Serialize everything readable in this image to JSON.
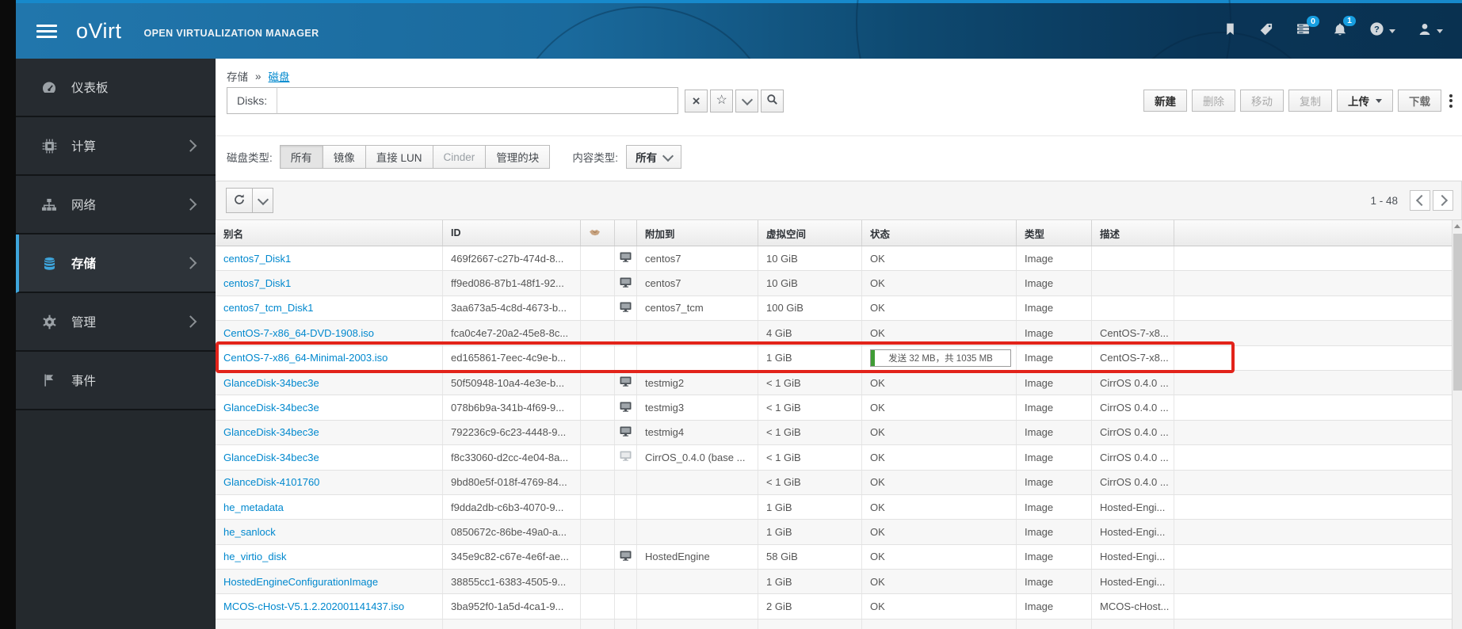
{
  "masthead": {
    "brand": "oVirt",
    "brand_sub": "OPEN VIRTUALIZATION MANAGER",
    "tasks_badge": "0",
    "alerts_badge": "1"
  },
  "sidebar": {
    "items": [
      {
        "label": "仪表板",
        "icon": "dashboard-gauge-icon",
        "active": false,
        "chevron": false
      },
      {
        "label": "计算",
        "icon": "compute-chip-icon",
        "active": false,
        "chevron": true
      },
      {
        "label": "网络",
        "icon": "network-sitemap-icon",
        "active": false,
        "chevron": true
      },
      {
        "label": "存储",
        "icon": "storage-database-icon",
        "active": true,
        "chevron": true
      },
      {
        "label": "管理",
        "icon": "admin-gear-icon",
        "active": false,
        "chevron": true
      },
      {
        "label": "事件",
        "icon": "events-flag-icon",
        "active": false,
        "chevron": false
      }
    ]
  },
  "breadcrumb": {
    "section": "存储",
    "separator": "»",
    "current": "磁盘"
  },
  "search": {
    "label": "Disks:",
    "value": ""
  },
  "actions": {
    "new": "新建",
    "delete": "删除",
    "move": "移动",
    "copy": "复制",
    "upload": "上传",
    "download": "下载"
  },
  "filters": {
    "disk_type_label": "磁盘类型:",
    "disk_type_options": [
      {
        "label": "所有",
        "active": true
      },
      {
        "label": "镜像",
        "active": false
      },
      {
        "label": "直接 LUN",
        "active": false
      },
      {
        "label": "Cinder",
        "active": false
      },
      {
        "label": "管理的块",
        "active": false
      }
    ],
    "content_type_label": "内容类型:",
    "content_type_value": "所有"
  },
  "grid": {
    "range": "1 - 48"
  },
  "table": {
    "columns": {
      "alias": "别名",
      "id": "ID",
      "attached": "附加到",
      "vsize": "虚拟空间",
      "status": "状态",
      "type": "类型",
      "desc": "描述"
    },
    "rows": [
      {
        "alias": "centos7_Disk1",
        "id": "469f2667-c27b-474d-8...",
        "attach": "vm",
        "attached_to": "centos7",
        "size": "10 GiB",
        "status": "OK",
        "type": "Image",
        "desc": ""
      },
      {
        "alias": "centos7_Disk1",
        "id": "ff9ed086-87b1-48f1-92...",
        "attach": "vm",
        "attached_to": "centos7",
        "size": "10 GiB",
        "status": "OK",
        "type": "Image",
        "desc": ""
      },
      {
        "alias": "centos7_tcm_Disk1",
        "id": "3aa673a5-4c8d-4673-b...",
        "attach": "vm",
        "attached_to": "centos7_tcm",
        "size": "100 GiB",
        "status": "OK",
        "type": "Image",
        "desc": ""
      },
      {
        "alias": "CentOS-7-x86_64-DVD-1908.iso",
        "id": "fca0c4e7-20a2-45e8-8c...",
        "attach": "",
        "attached_to": "",
        "size": "4 GiB",
        "status": "OK",
        "type": "Image",
        "desc": "CentOS-7-x8..."
      },
      {
        "alias": "CentOS-7-x86_64-Minimal-2003.iso",
        "id": "ed165861-7eec-4c9e-b...",
        "attach": "",
        "attached_to": "",
        "size": "1 GiB",
        "status": "",
        "progress": {
          "text": "发送 32 MB，共 1035 MB",
          "percent": 3
        },
        "type": "Image",
        "desc": "CentOS-7-x8..."
      },
      {
        "alias": "GlanceDisk-34bec3e",
        "id": "50f50948-10a4-4e3e-b...",
        "attach": "vm",
        "attached_to": "testmig2",
        "size": "< 1 GiB",
        "status": "OK",
        "type": "Image",
        "desc": "CirrOS 0.4.0 ..."
      },
      {
        "alias": "GlanceDisk-34bec3e",
        "id": "078b6b9a-341b-4f69-9...",
        "attach": "vm",
        "attached_to": "testmig3",
        "size": "< 1 GiB",
        "status": "OK",
        "type": "Image",
        "desc": "CirrOS 0.4.0 ..."
      },
      {
        "alias": "GlanceDisk-34bec3e",
        "id": "792236c9-6c23-4448-9...",
        "attach": "vm",
        "attached_to": "testmig4",
        "size": "< 1 GiB",
        "status": "OK",
        "type": "Image",
        "desc": "CirrOS 0.4.0 ..."
      },
      {
        "alias": "GlanceDisk-34bec3e",
        "id": "f8c33060-d2cc-4e04-8a...",
        "attach": "template",
        "attached_to": "CirrOS_0.4.0 (base ...",
        "size": "< 1 GiB",
        "status": "OK",
        "type": "Image",
        "desc": "CirrOS 0.4.0 ..."
      },
      {
        "alias": "GlanceDisk-4101760",
        "id": "9bd80e5f-018f-4769-84...",
        "attach": "",
        "attached_to": "",
        "size": "< 1 GiB",
        "status": "OK",
        "type": "Image",
        "desc": "CirrOS 0.4.0 ..."
      },
      {
        "alias": "he_metadata",
        "id": "f9dda2db-c6b3-4070-9...",
        "attach": "",
        "attached_to": "",
        "size": "1 GiB",
        "status": "OK",
        "type": "Image",
        "desc": "Hosted-Engi..."
      },
      {
        "alias": "he_sanlock",
        "id": "0850672c-86be-49a0-a...",
        "attach": "",
        "attached_to": "",
        "size": "1 GiB",
        "status": "OK",
        "type": "Image",
        "desc": "Hosted-Engi..."
      },
      {
        "alias": "he_virtio_disk",
        "id": "345e9c82-c67e-4e6f-ae...",
        "attach": "vm",
        "attached_to": "HostedEngine",
        "size": "58 GiB",
        "status": "OK",
        "type": "Image",
        "desc": "Hosted-Engi..."
      },
      {
        "alias": "HostedEngineConfigurationImage",
        "id": "38855cc1-6383-4505-9...",
        "attach": "",
        "attached_to": "",
        "size": "1 GiB",
        "status": "OK",
        "type": "Image",
        "desc": "Hosted-Engi..."
      },
      {
        "alias": "MCOS-cHost-V5.1.2.202001141437.iso",
        "id": "3ba952f0-1a5d-4ca1-9...",
        "attach": "",
        "attached_to": "",
        "size": "2 GiB",
        "status": "OK",
        "type": "Image",
        "desc": "MCOS-cHost..."
      }
    ]
  },
  "colors": {
    "accent": "#0088ce",
    "sidebar_active": "#3ea6dd",
    "highlight_red": "#e2231a",
    "progress_green": "#3f9c35",
    "masthead_dark": "#0b3a5c"
  }
}
